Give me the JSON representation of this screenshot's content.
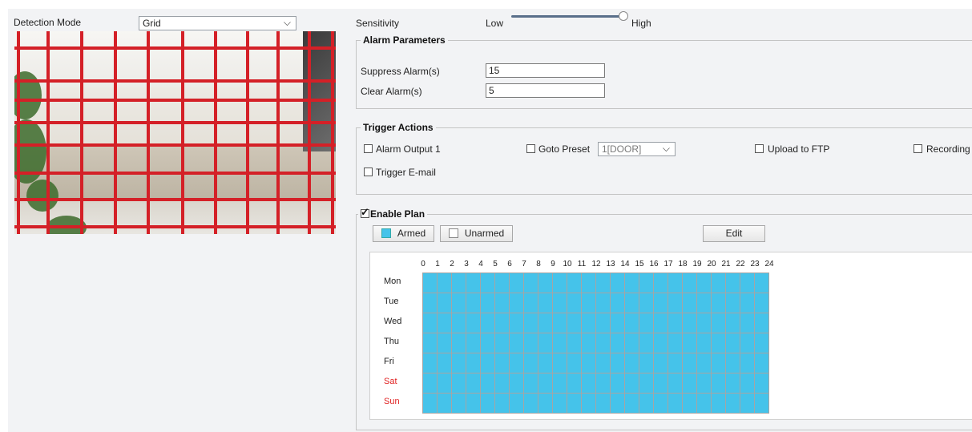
{
  "detection_mode": {
    "label": "Detection Mode",
    "value": "Grid"
  },
  "sensitivity": {
    "label": "Sensitivity",
    "low": "Low",
    "high": "High",
    "level": 1.0
  },
  "alarm_parameters": {
    "title": "Alarm Parameters",
    "suppress_label": "Suppress Alarm(s)",
    "suppress_value": "15",
    "clear_label": "Clear Alarm(s)",
    "clear_value": "5"
  },
  "trigger_actions": {
    "title": "Trigger Actions",
    "alarm_output": "Alarm Output 1",
    "goto_preset": "Goto Preset",
    "preset_value": "1[DOOR]",
    "upload_ftp": "Upload to FTP",
    "recording": "Recording",
    "trigger_email": "Trigger E-mail"
  },
  "plan": {
    "title": "Enable Plan",
    "enabled": true,
    "armed_label": "Armed",
    "unarmed_label": "Unarmed",
    "edit_label": "Edit",
    "armed_color": "#45c3ea",
    "hours": [
      "0",
      "1",
      "2",
      "3",
      "4",
      "5",
      "6",
      "7",
      "8",
      "9",
      "10",
      "11",
      "12",
      "13",
      "14",
      "15",
      "16",
      "17",
      "18",
      "19",
      "20",
      "21",
      "22",
      "23",
      "24"
    ],
    "days": [
      "Mon",
      "Tue",
      "Wed",
      "Thu",
      "Fri",
      "Sat",
      "Sun"
    ]
  },
  "colors": {
    "grid_line": "#d42027",
    "weekend": "#e02020",
    "panel_bg": "#f2f3f5"
  }
}
